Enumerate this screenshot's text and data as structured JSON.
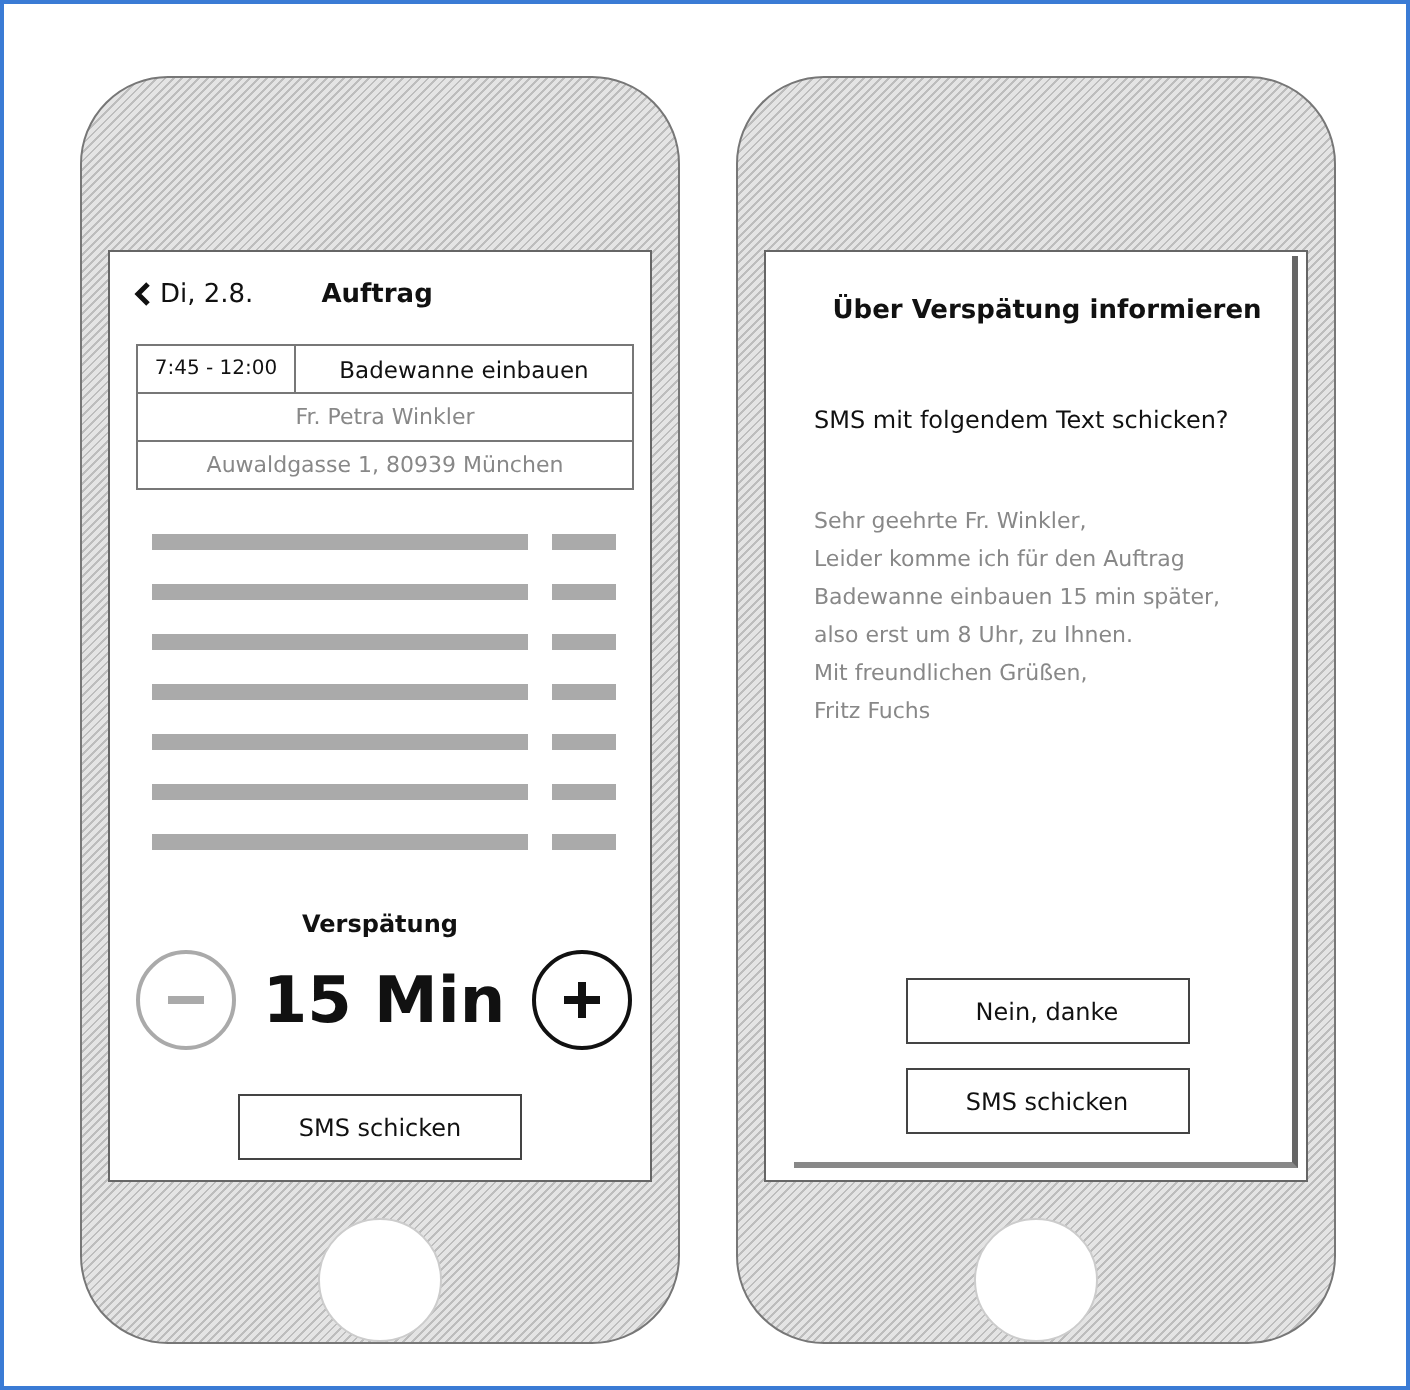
{
  "phones": [
    {
      "kind": "order",
      "header": {
        "back": "Di, 2.8.",
        "title": "Auftrag"
      },
      "order": {
        "time": "7:45 - 12:00",
        "task": "Badewanne einbauen",
        "customer": "Fr. Petra Winkler",
        "address": "Auwaldgasse 1, 80939 München"
      },
      "delay": {
        "label": "Verspätung",
        "value": "15 Min",
        "decrease": {
          "disabled": true
        },
        "increase": {
          "disabled": false
        }
      },
      "send_button": "SMS schicken"
    },
    {
      "kind": "dialog",
      "title": "Über Verspätung informieren",
      "question": "SMS mit folgendem Text schicken?",
      "message": "Sehr geehrte Fr. Winkler,\nLeider komme ich für den Auftrag\nBadewanne einbauen 15 min später,\nalso erst um 8 Uhr, zu Ihnen.\nMit freundlichen Grüßen,\nFritz Fuchs",
      "buttons": [
        "Nein, danke",
        "SMS schicken"
      ]
    }
  ]
}
